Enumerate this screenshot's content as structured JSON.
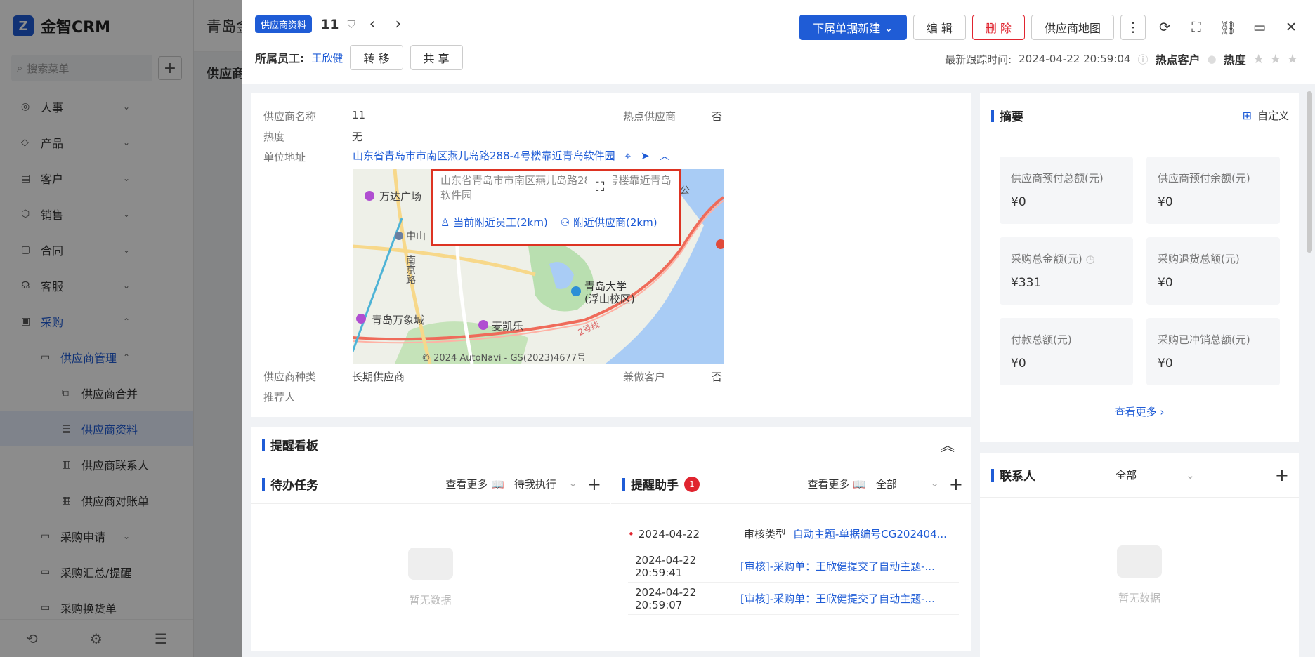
{
  "app": {
    "brand": "金智CRM",
    "header_title": "青岛金",
    "subheader": "供应商",
    "search_placeholder": "搜索菜单",
    "menu": [
      {
        "label": "人事",
        "state": "collapsed"
      },
      {
        "label": "产品",
        "state": "collapsed"
      },
      {
        "label": "客户",
        "state": "collapsed"
      },
      {
        "label": "销售",
        "state": "collapsed"
      },
      {
        "label": "合同",
        "state": "collapsed"
      },
      {
        "label": "客服",
        "state": "collapsed"
      },
      {
        "label": "采购",
        "state": "expanded"
      },
      {
        "label": "供应商管理",
        "state": "expanded"
      },
      {
        "label": "供应商合并"
      },
      {
        "label": "供应商资料"
      },
      {
        "label": "供应商联系人"
      },
      {
        "label": "供应商对账单"
      },
      {
        "label": "采购申请",
        "state": "collapsed"
      },
      {
        "label": "采购汇总/提醒",
        "state": "collapsed"
      },
      {
        "label": "采购换货单"
      }
    ]
  },
  "drawer": {
    "tag": "供应商资料",
    "record_no": "11",
    "owner_label": "所属员工:",
    "owner_name": "王欣健",
    "transfer_btn": "转 移",
    "share_btn": "共 享",
    "new_sub_btn": "下属单据新建",
    "edit_btn": "编 辑",
    "delete_btn": "删 除",
    "map_btn": "供应商地图",
    "last_follow_label": "最新跟踪时间:",
    "last_follow_time": "2024-04-22 20:59:04",
    "hot_customer": "热点客户",
    "heat": "热度"
  },
  "info": {
    "name_label": "供应商名称",
    "name_value": "11",
    "hot_supplier_label": "热点供应商",
    "hot_supplier_value": "否",
    "heat_label": "热度",
    "heat_value": "无",
    "address_label": "单位地址",
    "address_value": "山东省青岛市市南区燕儿岛路288-4号楼靠近青岛软件园",
    "popup_address": "山东省青岛市市南区燕儿岛路288-4号楼靠近青岛软件园",
    "nearby_staff": "当前附近员工(2km)",
    "nearby_supplier": "附近供应商(2km)",
    "map_labels": {
      "wanda": "万达广场",
      "zhongshan": "中山",
      "nanjing": "南京路",
      "qingdao_univ": "青岛大学",
      "fushan": "(浮山校区)",
      "mixc": "青岛万象城",
      "mcd": "麦凯乐",
      "line2": "2号线",
      "forest": "林公",
      "copyright": "© 2024 AutoNavi - GS(2023)4677号"
    },
    "type_label": "供应商种类",
    "type_value": "长期供应商",
    "also_customer_label": "兼做客户",
    "also_customer_value": "否",
    "referrer_label": "推荐人"
  },
  "board": {
    "title": "提醒看板",
    "todo": {
      "title": "待办任务",
      "more": "查看更多",
      "filter": "待我执行",
      "empty": "暂无数据"
    },
    "assistant": {
      "title": "提醒助手",
      "badge": "1",
      "more": "查看更多",
      "filter": "全部",
      "rows": [
        {
          "date": "2024-04-22",
          "type": "审核类型",
          "subject": "自动主题-单据编号CG202404..."
        },
        {
          "date": "2024-04-22 20:59:41",
          "type": "",
          "subject": "[审核]-采购单：王欣健提交了自动主题-..."
        },
        {
          "date": "2024-04-22 20:59:07",
          "type": "",
          "subject": "[审核]-采购单：王欣健提交了自动主题-..."
        }
      ]
    }
  },
  "summary": {
    "title": "摘要",
    "customize": "自定义",
    "tiles": [
      {
        "label": "供应商预付总额(元)",
        "value": "¥0"
      },
      {
        "label": "供应商预付余额(元)",
        "value": "¥0"
      },
      {
        "label": "采购总金额(元)",
        "value": "¥331"
      },
      {
        "label": "采购退货总额(元)",
        "value": "¥0"
      },
      {
        "label": "付款总额(元)",
        "value": "¥0"
      },
      {
        "label": "采购已冲销总额(元)",
        "value": "¥0"
      }
    ],
    "see_more": "查看更多"
  },
  "contacts": {
    "title": "联系人",
    "filter": "全部",
    "empty": "暂无数据"
  },
  "colors": {
    "accent": "#1f5cd6",
    "danger": "#e0242f",
    "popup_border": "#dd3322"
  }
}
